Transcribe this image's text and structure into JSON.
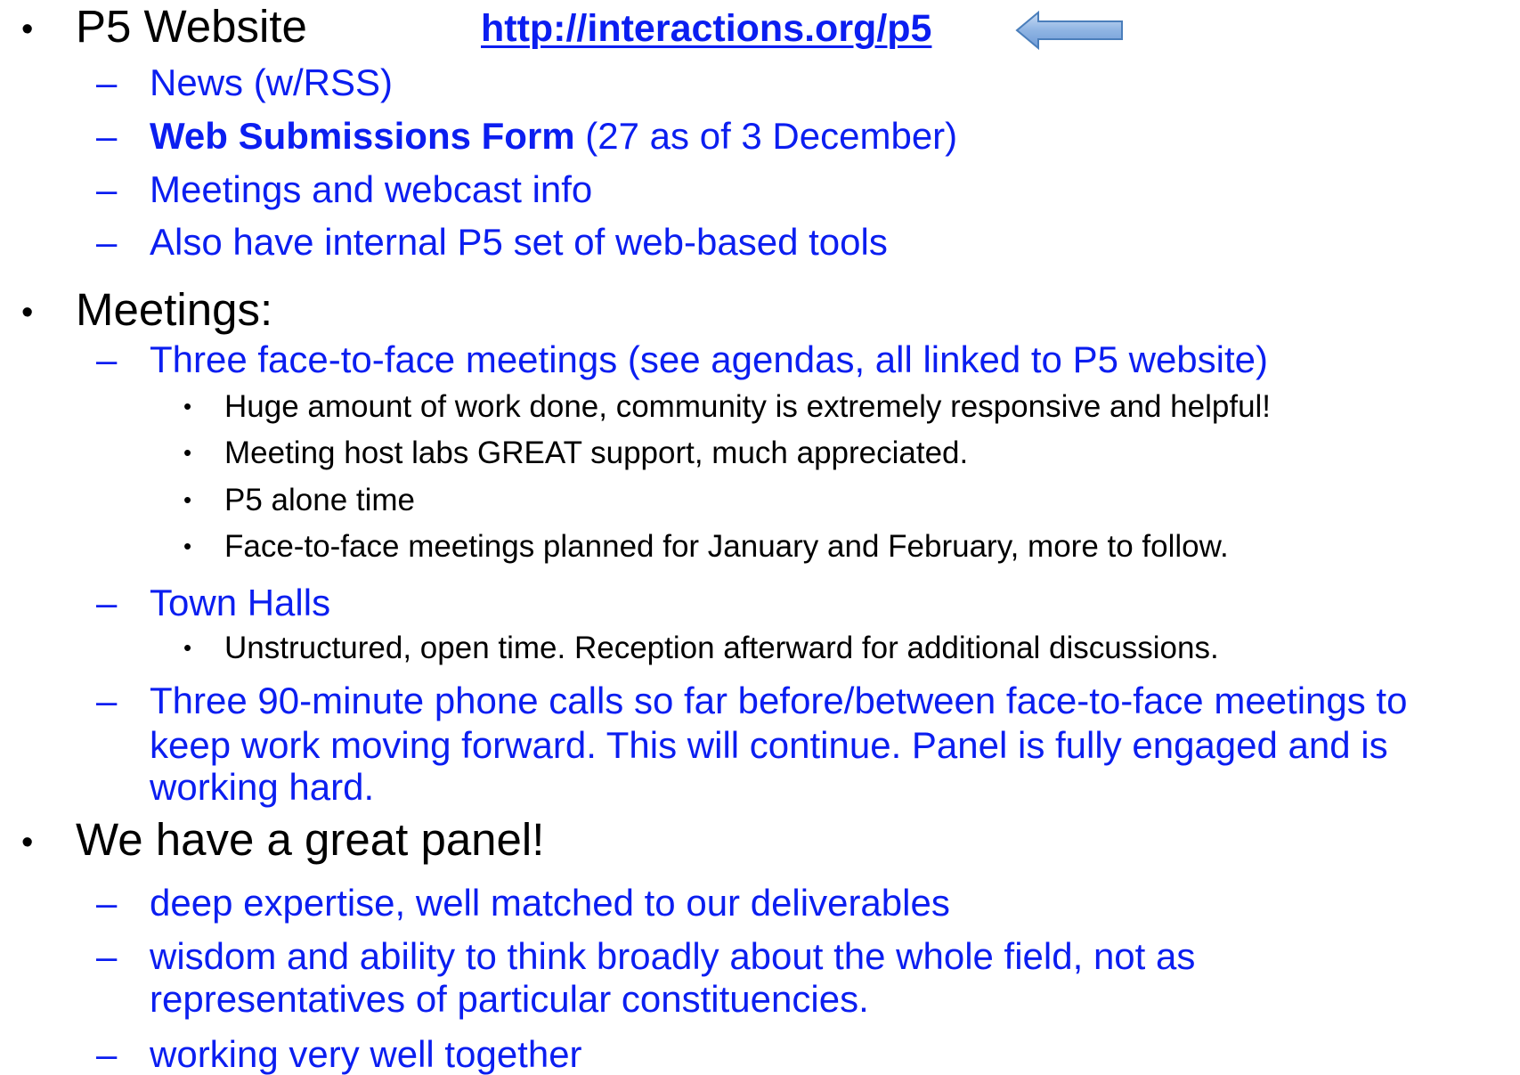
{
  "section1": {
    "heading": "P5 Website",
    "url": "http://interactions.org/p5",
    "arrow_icon": "left-arrow-icon",
    "items": [
      "News (w/RSS)",
      "Web Submissions Form",
      "Meetings and webcast info",
      "Also have internal P5 set of web-based tools"
    ],
    "submissions_note": " (27 as of 3 December)"
  },
  "section2": {
    "heading": "Meetings:",
    "face_to_face": "Three face-to-face meetings (see agendas, all linked to P5 website)",
    "face_to_face_points": [
      "Huge amount of work done, community is extremely responsive and helpful!",
      "Meeting host labs GREAT support, much appreciated.",
      "P5 alone time",
      "Face-to-face meetings planned for January and February, more to follow."
    ],
    "town_halls": "Town Halls",
    "town_halls_points": [
      "Unstructured, open time.  Reception afterward for additional discussions."
    ],
    "phone_calls_lines": [
      "Three 90-minute phone calls so far before/between face-to-face meetings to",
      "keep work moving forward.  This will continue.  Panel is fully engaged and is",
      "working hard."
    ]
  },
  "section3": {
    "heading": "We have a great panel!",
    "item1": "deep expertise, well matched to our deliverables",
    "item2_lines": [
      "wisdom and ability to think broadly about the whole field, not as",
      "representatives of particular constituencies."
    ],
    "item3": "working very well together"
  },
  "colors": {
    "accent_blue": "#0b1ef0",
    "arrow_fill": "#8fb4e3",
    "arrow_stroke": "#4a7ebb"
  }
}
